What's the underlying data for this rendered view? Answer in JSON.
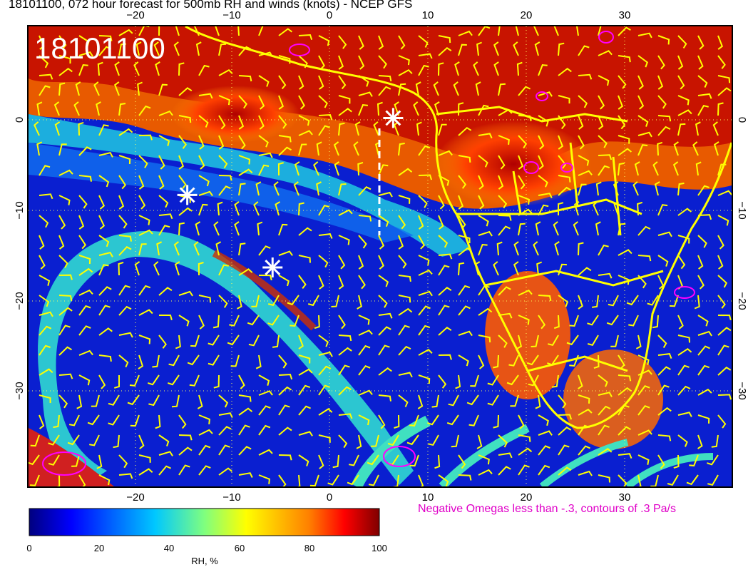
{
  "title": "18101100, 072 hour forecast for 500mb RH and winds (knots) - NCEP GFS",
  "stamp": "18101100",
  "omega_note": "Negative Omegas less than -.3, contours of .3 Pa/s",
  "colorbar": {
    "label": "RH, %",
    "ticks": [
      "0",
      "20",
      "40",
      "60",
      "80",
      "100"
    ],
    "colors": [
      "#00007f",
      "#0000ff",
      "#007fff",
      "#00ffff",
      "#7fff7f",
      "#ffff00",
      "#ff7f00",
      "#ff0000",
      "#7f0000"
    ]
  },
  "axes": {
    "lon_ticks": [
      "−20",
      "−10",
      "0",
      "10",
      "20",
      "30"
    ],
    "lat_ticks": [
      "0",
      "−10",
      "−20",
      "−30"
    ]
  },
  "colors": {
    "coast": "#ffff00",
    "omega": "#ff00ff",
    "markers": "#ffffff",
    "note": "#e000c8"
  },
  "markers": [
    {
      "lon": 6.5,
      "lat": 0.2
    },
    {
      "lon": -14.5,
      "lat": -8.3
    },
    {
      "lon": -5.8,
      "lat": -16.3
    }
  ]
}
